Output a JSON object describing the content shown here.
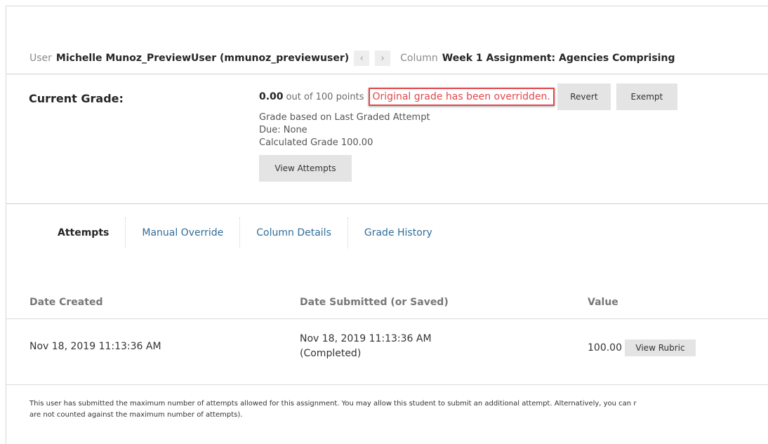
{
  "header": {
    "user_label": "User",
    "user_value": "Michelle Munoz_PreviewUser (mmunoz_previewuser)",
    "prev_icon": "‹",
    "next_icon": "›",
    "column_label": "Column",
    "column_value": "Week 1 Assignment: Agencies Comprising"
  },
  "grade": {
    "title": "Current Grade:",
    "score": "0.00",
    "out_of": "out of 100 points",
    "override_message": "Original grade has been overridden.",
    "revert_label": "Revert",
    "exempt_label": "Exempt",
    "based_on": "Grade based on Last Graded Attempt",
    "due": "Due: None",
    "calculated": "Calculated Grade  100.00",
    "view_attempts_label": "View Attempts"
  },
  "tabs": [
    {
      "label": "Attempts",
      "active": true
    },
    {
      "label": "Manual Override",
      "active": false
    },
    {
      "label": "Column Details",
      "active": false
    },
    {
      "label": "Grade History",
      "active": false
    }
  ],
  "table": {
    "headers": [
      "Date Created",
      "Date Submitted (or Saved)",
      "Value"
    ],
    "rows": [
      {
        "date_created": "Nov 18, 2019 11:13:36 AM",
        "date_submitted": "Nov 18, 2019 11:13:36 AM",
        "status": "(Completed)",
        "value": "100.00",
        "rubric_label": "View Rubric"
      }
    ]
  },
  "notice": {
    "line1": "This user has submitted the maximum number of attempts allowed for this assignment. You may allow this student to submit an additional attempt. Alternatively, you can r",
    "line2": "are not counted against the maximum number of attempts)."
  },
  "colors": {
    "accent_link": "#2f6d9a",
    "override_red": "#e0474c",
    "button_gray": "#e4e4e4"
  }
}
